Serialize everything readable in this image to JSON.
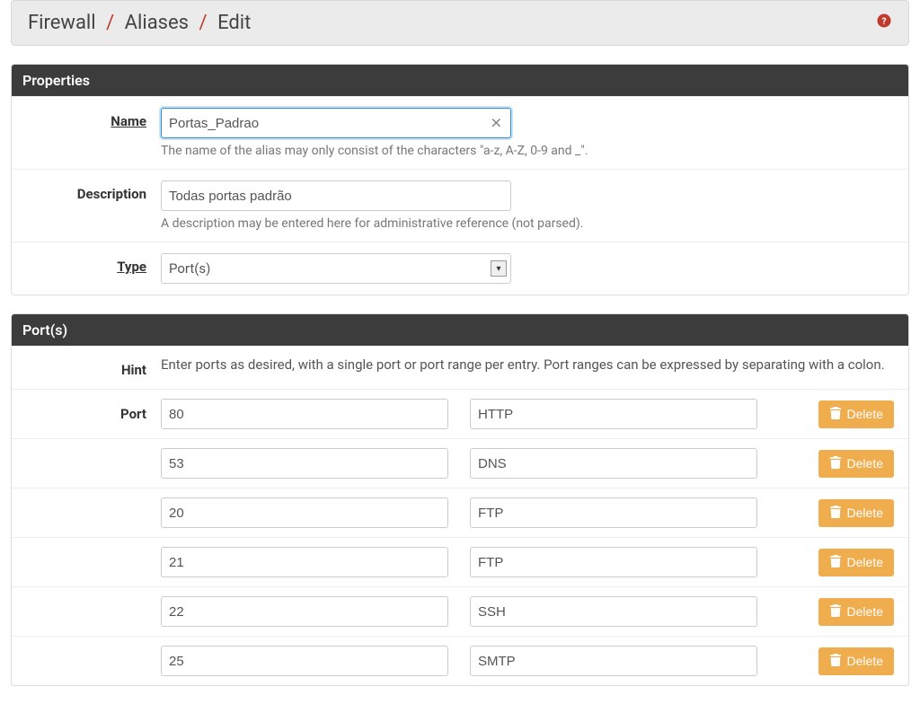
{
  "breadcrumb": {
    "item1": "Firewall",
    "item2": "Aliases",
    "item3": "Edit"
  },
  "panels": {
    "properties": {
      "title": "Properties",
      "name_label": "Name",
      "name_value": "Portas_Padrao",
      "name_help": "The name of the alias may only consist of the characters \"a-z, A-Z, 0-9 and _\".",
      "desc_label": "Description",
      "desc_value": "Todas portas padrão",
      "desc_help": "A description may be entered here for administrative reference (not parsed).",
      "type_label": "Type",
      "type_value": "Port(s)"
    },
    "ports": {
      "title": "Port(s)",
      "hint_label": "Hint",
      "hint_text": "Enter ports as desired, with a single port or port range per entry. Port ranges can be expressed by separating with a colon.",
      "port_label": "Port",
      "delete_label": "Delete",
      "rows": [
        {
          "port": "80",
          "desc": "HTTP"
        },
        {
          "port": "53",
          "desc": "DNS"
        },
        {
          "port": "20",
          "desc": "FTP"
        },
        {
          "port": "21",
          "desc": "FTP"
        },
        {
          "port": "22",
          "desc": "SSH"
        },
        {
          "port": "25",
          "desc": "SMTP"
        }
      ]
    }
  }
}
